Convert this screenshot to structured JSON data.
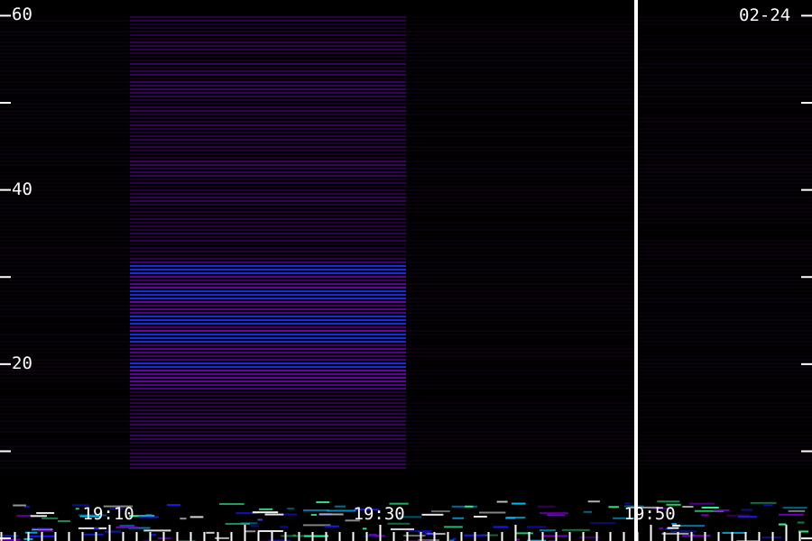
{
  "chart_data": {
    "type": "heatmap",
    "title": "",
    "date_label": "02-24",
    "xlabel": "",
    "ylabel": "",
    "y_ticks": [
      0,
      10,
      20,
      30,
      40,
      50,
      60
    ],
    "y_tick_labels": [
      "20",
      "40",
      "60"
    ],
    "y_labeled_values": [
      20,
      40,
      60
    ],
    "ylim": [
      -0.3,
      61.8
    ],
    "x_ticks": [
      "19:10",
      "19:30",
      "19:50"
    ],
    "x_tick_minutes": [
      10,
      30,
      50
    ],
    "xlim_minutes": [
      1.9,
      61.9
    ],
    "cursor_minutes": 48.9,
    "segments": [
      {
        "start_minutes": 1.9,
        "end_minutes": 11.5,
        "intensity": "low"
      },
      {
        "start_minutes": 11.5,
        "end_minutes": 31.9,
        "intensity": "high"
      },
      {
        "start_minutes": 31.9,
        "end_minutes": 48.9,
        "intensity": "low"
      },
      {
        "start_minutes": 48.9,
        "end_minutes": 61.9,
        "intensity": "low"
      }
    ],
    "strong_bands": [
      20,
      23,
      25,
      28,
      31
    ],
    "colors": {
      "background": "#000000",
      "low": "#3a0a4a",
      "mid": "#7a00c8",
      "high": "#1830ff",
      "peak": "#ffffff",
      "cursor": "#ffffff"
    }
  }
}
